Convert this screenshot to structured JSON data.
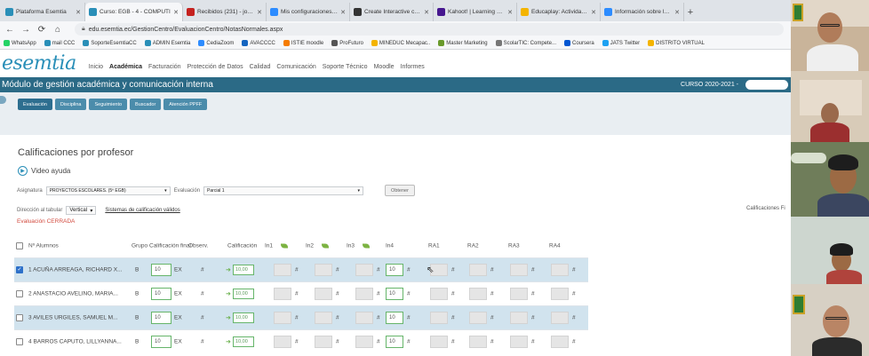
{
  "browser": {
    "tabs": [
      {
        "title": "Plataforma Esemtia",
        "color": "#2a8fb8"
      },
      {
        "title": "Curso: EGB - 4 - COMPUTI",
        "color": "#2a8fb8",
        "active": true
      },
      {
        "title": "Recibidos (231) - jorgeteb",
        "color": "#c5221f"
      },
      {
        "title": "Mis configuraciones - Zoo",
        "color": "#2d8cff"
      },
      {
        "title": "Create Interactive conten",
        "color": "#333333"
      },
      {
        "title": "Kahoot! | Learning games",
        "color": "#46178f"
      },
      {
        "title": "Educaplay: Actividades ed",
        "color": "#f4b400"
      },
      {
        "title": "Información sobre la reuni",
        "color": "#2d8cff"
      }
    ],
    "url": "edu.esemtia.ec/GestionCentro/EvaluacionCentro/NotasNormales.aspx",
    "bookmarks": [
      {
        "label": "WhatsApp",
        "color": "#25d366"
      },
      {
        "label": "mail CCC",
        "color": "#2a8fb8"
      },
      {
        "label": "SoporteEsemtiaCC",
        "color": "#2a8fb8"
      },
      {
        "label": "ADMIN Esemtia",
        "color": "#2a8fb8"
      },
      {
        "label": "CediaZoom",
        "color": "#2d8cff"
      },
      {
        "label": "AVACCCC",
        "color": "#1565c0"
      },
      {
        "label": "ISTIE moodle",
        "color": "#f57c00"
      },
      {
        "label": "ProFuturo",
        "color": "#555555"
      },
      {
        "label": "MINEDUC Mecapac..",
        "color": "#f4b400"
      },
      {
        "label": "Master Marketing",
        "color": "#6a9a2c"
      },
      {
        "label": "ScolarTIC: Compete...",
        "color": "#777777"
      },
      {
        "label": "Coursera",
        "color": "#0056d2"
      },
      {
        "label": "JATS Twitter",
        "color": "#1da1f2"
      },
      {
        "label": "DISTRITO VIRTUAL",
        "color": "#f4b400"
      }
    ]
  },
  "app": {
    "logo": "esemtia",
    "nav": [
      "Inicio",
      "Académica",
      "Facturación",
      "Protección de Datos",
      "Calidad",
      "Comunicación",
      "Soporte Técnico",
      "Moodle",
      "Informes"
    ],
    "module_title": "Módulo de gestión académica y comunicación interna",
    "course": "CURSO 2020-2021 -",
    "subtabs": [
      "Evaluación",
      "Disciplina",
      "Seguimiento",
      "Buscador",
      "Atención PPFF"
    ]
  },
  "page": {
    "title": "Calificaciones por profesor",
    "video_help": "Video ayuda",
    "asignatura_label": "Asignatura",
    "asignatura_value": "PROYECTOS ESCOLARES. (5º EGB)",
    "evaluacion_label": "Evaluación",
    "evaluacion_value": "Parcial 1",
    "obtener": "Obtener",
    "direccion_label": "Dirección al tabular",
    "direccion_value": "Vertical",
    "sistemas_link": "Sistemas de calificación válidos",
    "closed": "Evaluación CERRADA",
    "right_label": "Calificaciones Fi"
  },
  "table": {
    "headers": [
      "Nº Alumnos",
      "Grupo",
      "Calificación final",
      "Observ.",
      "Calificación",
      "In1",
      "In2",
      "In3",
      "In4",
      "RA1",
      "RA2",
      "RA3",
      "RA4"
    ],
    "rows": [
      {
        "n": "1",
        "name": "ACUÑA ARREAGA, RICHARD X...",
        "group": "B",
        "final": "10",
        "obs": "EX",
        "calif": "10,00",
        "in4": "10",
        "checked": true
      },
      {
        "n": "2",
        "name": "ANASTACIO AVELINO, MARIA...",
        "group": "B",
        "final": "10",
        "obs": "EX",
        "calif": "10,00",
        "in4": "10",
        "checked": false
      },
      {
        "n": "3",
        "name": "AVILES URGILES, SAMUEL M...",
        "group": "B",
        "final": "10",
        "obs": "EX",
        "calif": "10,00",
        "in4": "10",
        "checked": false
      },
      {
        "n": "4",
        "name": "BARROS CAPUTO, LILLYANNA...",
        "group": "B",
        "final": "10",
        "obs": "EX",
        "calif": "10,00",
        "in4": "10",
        "checked": false
      }
    ],
    "hash": "#"
  }
}
